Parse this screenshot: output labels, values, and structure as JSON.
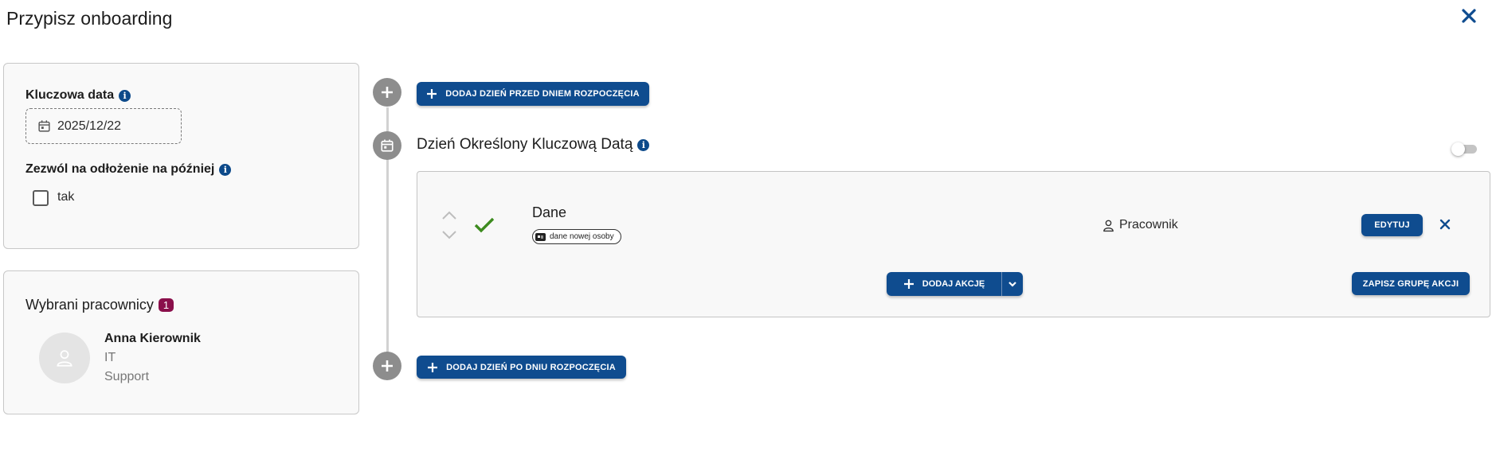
{
  "dialog": {
    "title": "Przypisz onboarding"
  },
  "settings": {
    "key_date_label": "Kluczowa data",
    "key_date_value": "2025/12/22",
    "postpone_label": "Zezwól na odłożenie na później",
    "postpone_option": "tak",
    "postpone_checked": false
  },
  "employees": {
    "title": "Wybrani pracownicy",
    "count": "1",
    "list": [
      {
        "name": "Anna Kierownik",
        "department": "IT",
        "team": "Support"
      }
    ]
  },
  "timeline": {
    "add_before_label": "DODAJ DZIEŃ PRZED DNIEM ROZPOCZĘCIA",
    "day_title": "Dzień Określony Kluczową Datą",
    "toggle_on": false,
    "add_after_label": "DODAJ DZIEŃ PO DNIU ROZPOCZĘCIA"
  },
  "action_group": {
    "action": {
      "name": "Dane",
      "tag": "dane nowej osoby",
      "owner": "Pracownik",
      "status": "completed"
    },
    "edit_label": "EDYTUJ",
    "add_action_label": "DODAJ AKCJĘ",
    "save_group_label": "ZAPISZ GRUPĘ AKCJI"
  },
  "colors": {
    "primary": "#0f4c8f",
    "badge": "#8a0f4b",
    "success": "#3d8b1f",
    "timeline": "#8d8d8d"
  },
  "icons": {
    "close": "close-icon",
    "info": "info-icon",
    "calendar": "calendar-icon",
    "plus": "plus-icon",
    "check": "check-icon",
    "person": "person-icon",
    "chevron": "chevron-down-icon"
  }
}
